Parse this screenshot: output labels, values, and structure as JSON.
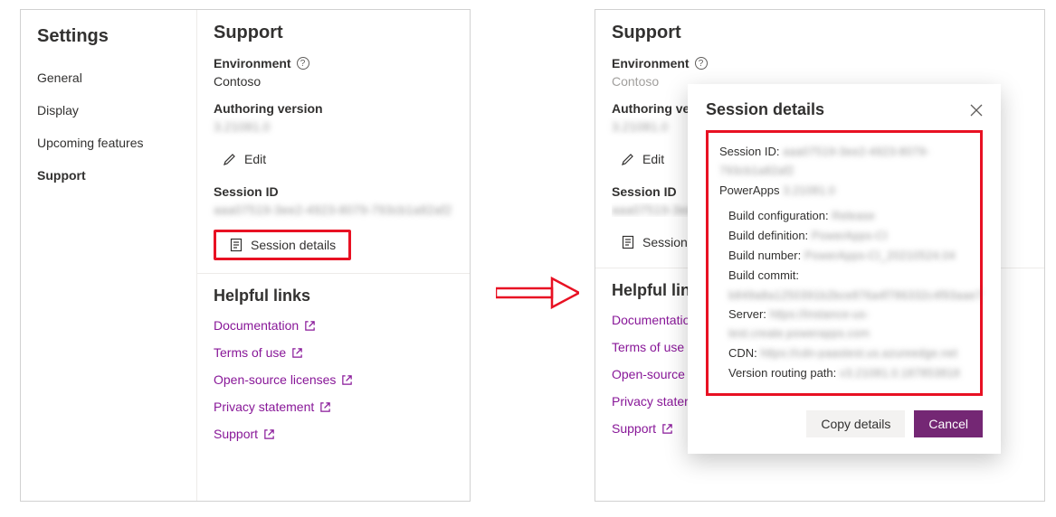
{
  "sidebar": {
    "title": "Settings",
    "items": [
      {
        "label": "General"
      },
      {
        "label": "Display"
      },
      {
        "label": "Upcoming features"
      },
      {
        "label": "Support"
      }
    ]
  },
  "support": {
    "title": "Support",
    "environment_label": "Environment",
    "environment_value": "Contoso",
    "authoring_label": "Authoring version",
    "authoring_value": "3.21081.0",
    "edit_label": "Edit",
    "session_id_label": "Session ID",
    "session_id_value": "aaa07519-3ee2-4923-8079-793cb1a82af2",
    "session_details_label": "Session details",
    "helpful_links_title": "Helpful links",
    "links": [
      {
        "label": "Documentation"
      },
      {
        "label": "Terms of use"
      },
      {
        "label": "Open-source licenses"
      },
      {
        "label": "Privacy statement"
      },
      {
        "label": "Support"
      }
    ]
  },
  "dialog": {
    "title": "Session details",
    "rows": {
      "session_id_k": "Session ID:",
      "session_id_v": "aaa07519-3ee2-4923-8079-793cb1a82af2",
      "powerapps_k": "PowerApps",
      "powerapps_v": "3.21081.0",
      "build_cfg_k": "Build configuration:",
      "build_cfg_v": "Release",
      "build_def_k": "Build definition:",
      "build_def_v": "PowerApps-CI",
      "build_num_k": "Build number:",
      "build_num_v": "PowerApps-CI_20210524.04",
      "build_commit_k": "Build commit:",
      "build_commit_v": "b849a8a1250391b2bce876a4f786332c4f93aae7",
      "server_k": "Server:",
      "server_v": "https://instance-us-test.create.powerapps.com",
      "cdn_k": "CDN:",
      "cdn_v": "https://cdn-paastest.us.azureedge.net",
      "vrp_k": "Version routing path:",
      "vrp_v": "v3.21081.0.187853818"
    },
    "copy_label": "Copy details",
    "cancel_label": "Cancel"
  }
}
